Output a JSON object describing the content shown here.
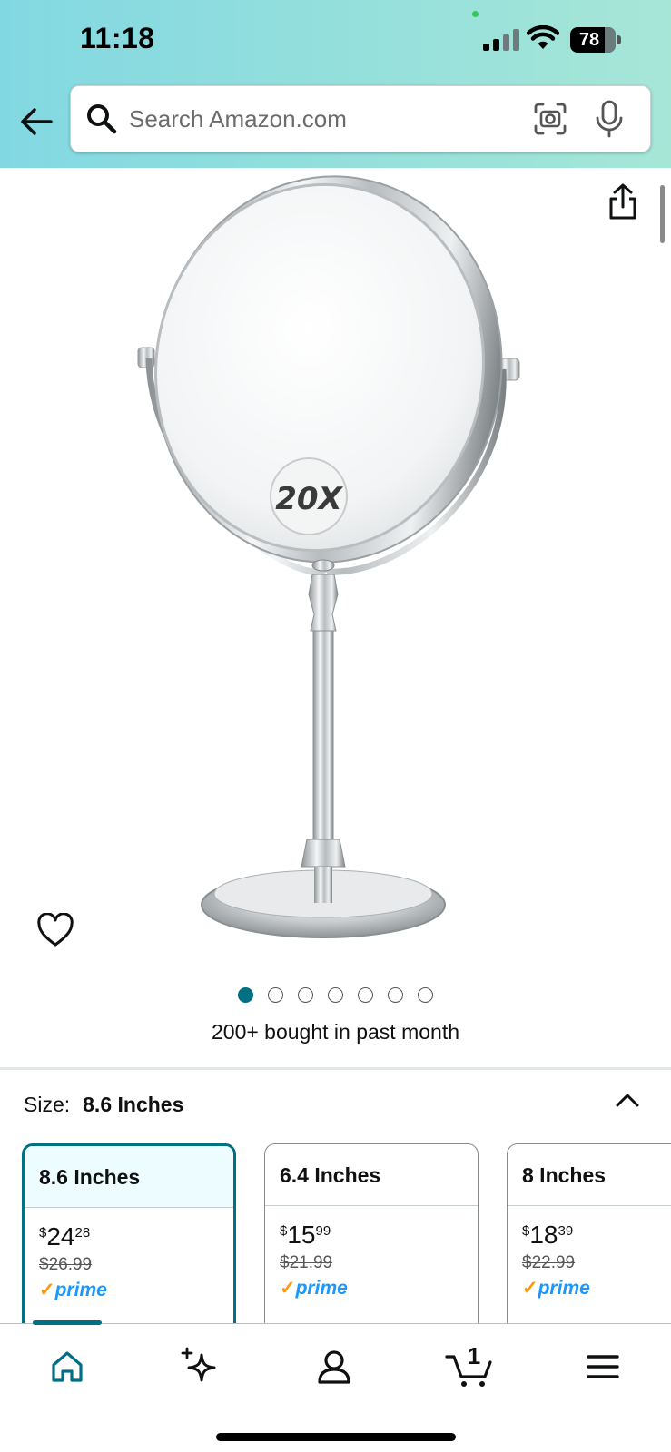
{
  "status_bar": {
    "time": "11:18",
    "battery": "78"
  },
  "search": {
    "placeholder": "Search Amazon.com"
  },
  "product": {
    "image_badge": "20X",
    "image_count": 7,
    "active_image_index": 0,
    "bought_text": "200+ bought in past month"
  },
  "size": {
    "label": "Size:",
    "selected_value": "8.6 Inches",
    "options": [
      {
        "name": "8.6 Inches",
        "price_symbol": "$",
        "price_whole": "24",
        "price_cents": "28",
        "list_price": "$26.99",
        "prime": "prime",
        "selected": true
      },
      {
        "name": "6.4 Inches",
        "price_symbol": "$",
        "price_whole": "15",
        "price_cents": "99",
        "list_price": "$21.99",
        "prime": "prime",
        "selected": false
      },
      {
        "name": "8 Inches",
        "price_symbol": "$",
        "price_whole": "18",
        "price_cents": "39",
        "list_price": "$22.99",
        "prime": "prime",
        "selected": false
      }
    ]
  },
  "bottom_nav": {
    "items": [
      "home-icon",
      "sparkle-icon",
      "account-icon",
      "cart-icon",
      "menu-icon"
    ],
    "cart_count": "1"
  },
  "colors": {
    "accent": "#007185",
    "prime_blue": "#1a98ff",
    "prime_check": "#ff9900"
  }
}
